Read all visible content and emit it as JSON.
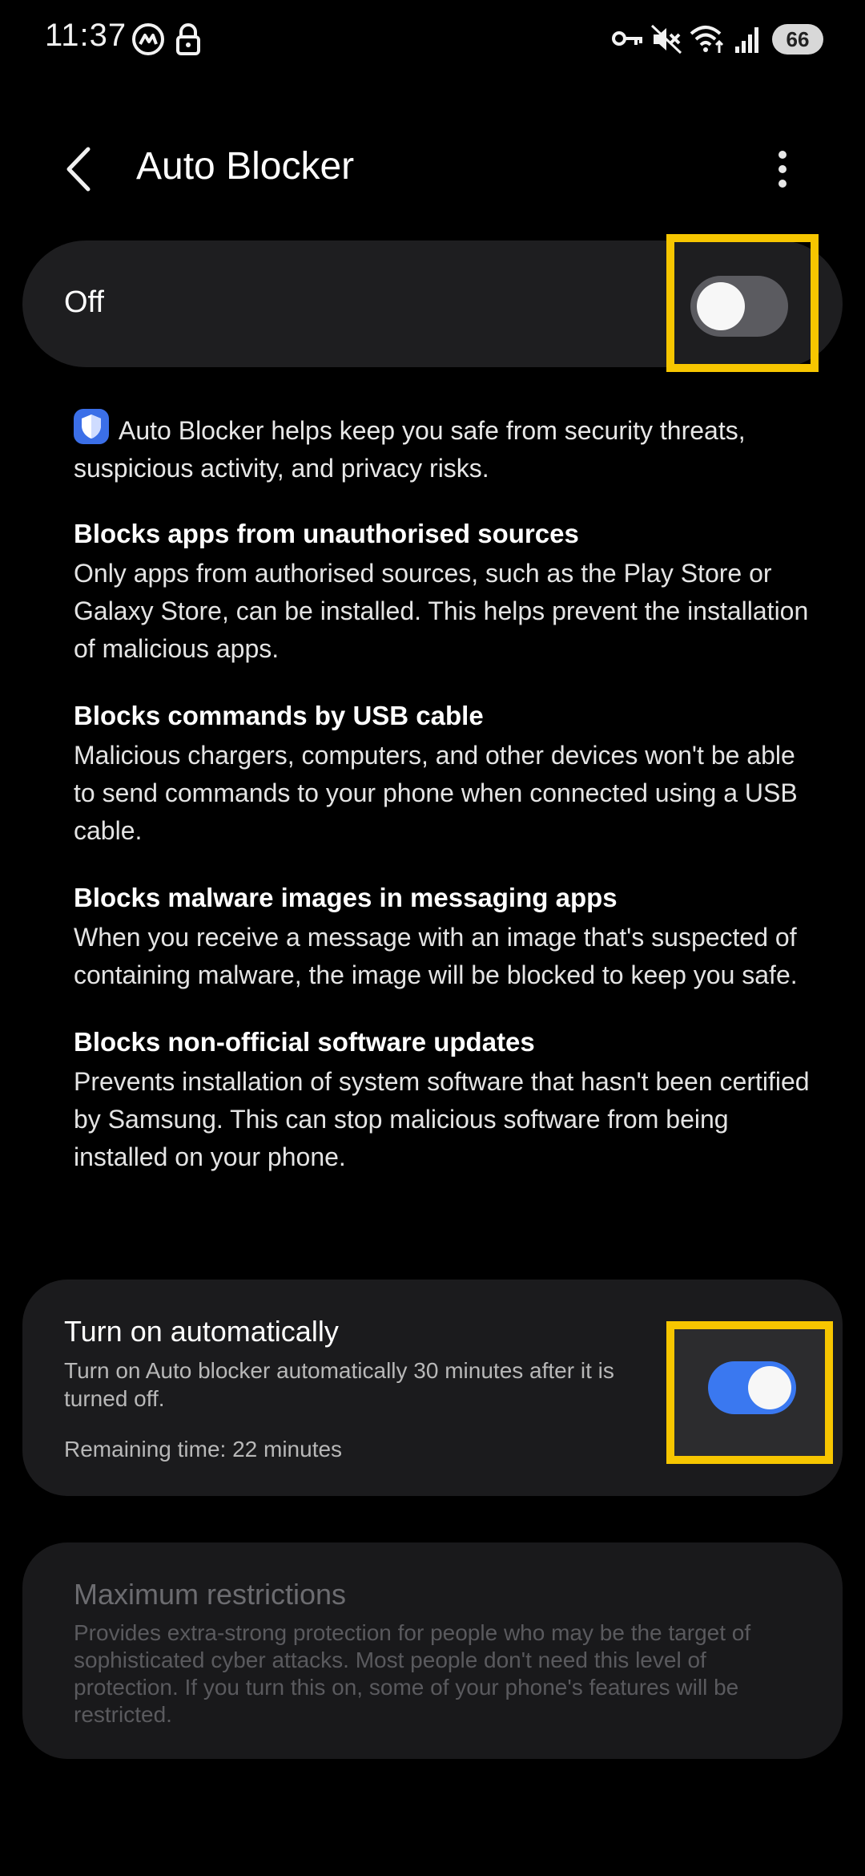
{
  "status_bar": {
    "time": "11:37",
    "battery": "66",
    "icons": [
      "messenger-icon",
      "lock-icon",
      "vpn-key-icon",
      "mute-icon",
      "wifi-icon",
      "signal-icon"
    ]
  },
  "app_bar": {
    "title": "Auto Blocker",
    "back_icon": "back-arrow-icon",
    "more_icon": "more-vert-icon"
  },
  "master_switch": {
    "label": "Off",
    "checked": false,
    "off_color": "#5b5b60"
  },
  "intro": {
    "icon": "shield-icon",
    "text": "Auto Blocker helps keep you safe from security threats, suspicious activity, and privacy risks."
  },
  "features": [
    {
      "title": "Blocks apps from unauthorised sources",
      "desc": "Only apps from authorised sources, such as the Play Store or Galaxy Store, can be installed. This helps prevent the installation of malicious apps."
    },
    {
      "title": "Blocks commands by USB cable",
      "desc": "Malicious chargers, computers, and other devices won't be able to send commands to your phone when connected using a USB cable."
    },
    {
      "title": "Blocks malware images in messaging apps",
      "desc": "When you receive a message with an image that's suspected of containing malware, the image will be blocked to keep you safe."
    },
    {
      "title": "Blocks non-official software updates",
      "desc": "Prevents installation of system software that hasn't been certified by Samsung. This can stop malicious software from being installed on your phone."
    }
  ],
  "auto_on": {
    "title": "Turn on automatically",
    "desc": "Turn on Auto blocker automatically 30 minutes after it is turned off.",
    "remaining": "Remaining time: 22 minutes",
    "checked": true,
    "on_color": "#3a78f0"
  },
  "max_restrictions": {
    "title": "Maximum restrictions",
    "desc": "Provides extra-strong protection for people who may be the target of sophisticated cyber attacks. Most people don't need this level of protection. If you turn this on, some of your phone's features will be restricted.",
    "enabled": false
  },
  "colors": {
    "highlight": "#f7c600",
    "background": "#000000",
    "card": "#1e1e20"
  }
}
